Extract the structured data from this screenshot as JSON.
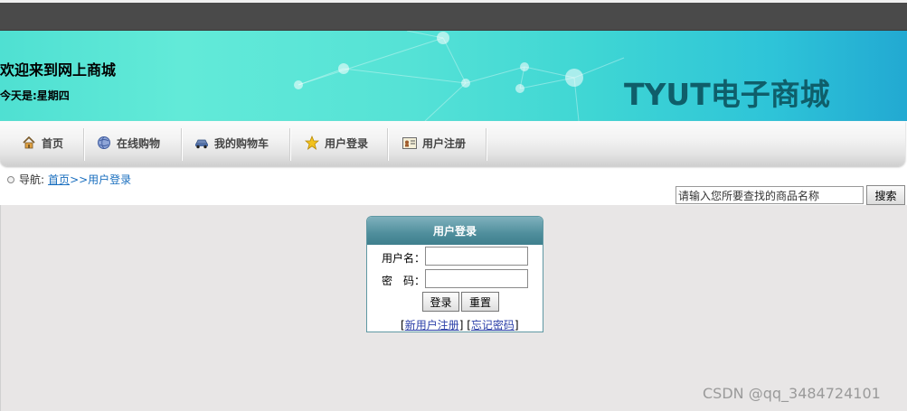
{
  "header": {
    "welcome": "欢迎来到网上商城",
    "today": "今天是:星期四",
    "brand": "TYUT电子商城"
  },
  "nav": {
    "items": [
      {
        "label": "首页",
        "icon": "home-icon"
      },
      {
        "label": "在线购物",
        "icon": "globe-icon"
      },
      {
        "label": "我的购物车",
        "icon": "car-icon"
      },
      {
        "label": "用户登录",
        "icon": "star-icon"
      },
      {
        "label": "用户注册",
        "icon": "id-card-icon"
      }
    ]
  },
  "breadcrumb": {
    "prefix": "导航:",
    "home": "首页",
    "sep": ">>",
    "current": "用户登录"
  },
  "search": {
    "value": "请输入您所要查找的商品名称",
    "button": "搜索"
  },
  "login": {
    "title": "用户登录",
    "username_label": "用户名：",
    "password_label": "密　码：",
    "username_value": "",
    "password_value": "",
    "login_button": "登录",
    "reset_button": "重置",
    "register_link": "新用户注册",
    "forgot_link": "忘记密码"
  },
  "watermark": "CSDN @qq_3484724101",
  "colors": {
    "topbar": "#4a4a4a",
    "brand": "#0f5e6a",
    "login_header": "#4f8e9c",
    "content_bg": "#e8e6e6",
    "link": "#1a6fbf"
  }
}
